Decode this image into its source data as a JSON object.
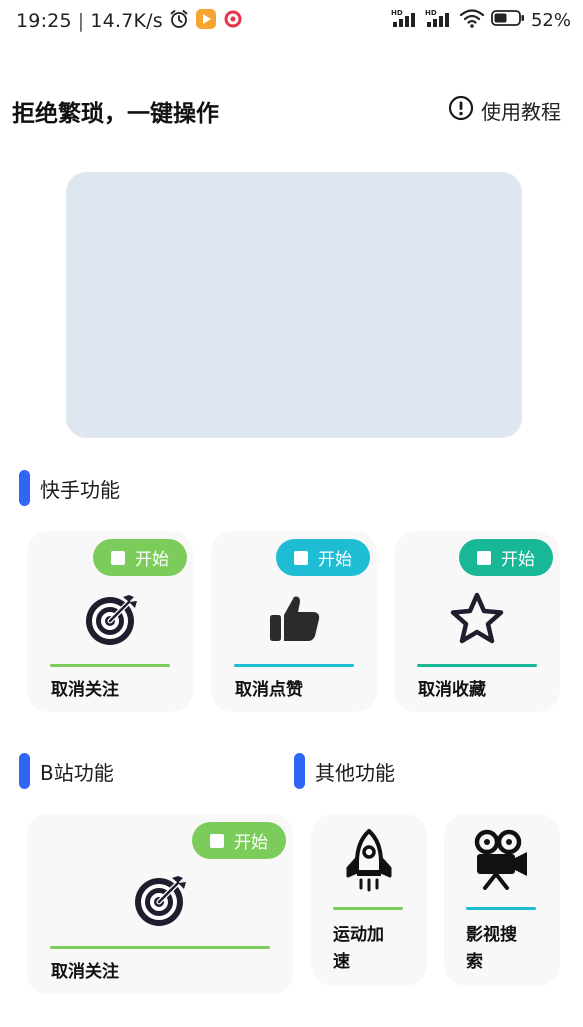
{
  "status_bar": {
    "time": "19:25",
    "speed": "14.7K/s",
    "battery_pct": "52%",
    "battery_level": 0.52
  },
  "header": {
    "title": "拒绝繁琐，一键操作",
    "tutorial_label": "使用教程"
  },
  "sections": {
    "kuaishou": {
      "title": "快手功能"
    },
    "bilibili": {
      "title": "B站功能"
    },
    "other": {
      "title": "其他功能"
    }
  },
  "cards": {
    "ks_unfollow": {
      "start": "开始",
      "label": "取消关注",
      "color": "#7ccc5c"
    },
    "ks_unlike": {
      "start": "开始",
      "label": "取消点赞",
      "color": "#1fbdd4"
    },
    "ks_unfavorite": {
      "start": "开始",
      "label": "取消收藏",
      "color": "#18b796"
    },
    "bili_unfollow": {
      "start": "开始",
      "label": "取消关注",
      "color": "#7ccc5c"
    },
    "sport_speed": {
      "label_line1": "运动加",
      "label_line2": "速",
      "color": "#7ccc5c"
    },
    "video_search": {
      "label_line1": "影视搜",
      "label_line2": "索",
      "color": "#1fbdd4"
    }
  },
  "icons": {
    "alarm": "alarm-icon",
    "signal": "signal-icon",
    "wifi": "wifi-icon",
    "battery": "battery-icon",
    "info": "info-icon",
    "target": "target-icon",
    "thumbs_up": "thumbs-up-icon",
    "star": "star-icon",
    "rocket": "rocket-icon",
    "camera": "movie-camera-icon"
  }
}
